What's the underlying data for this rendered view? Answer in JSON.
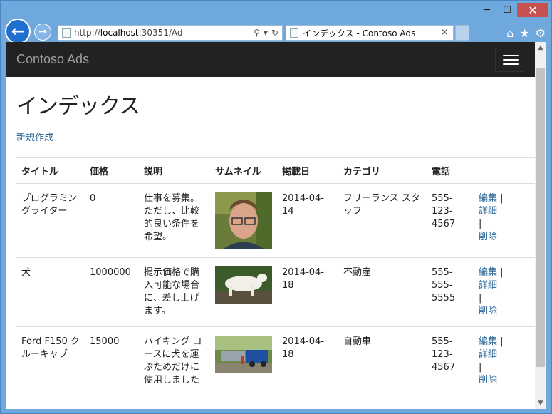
{
  "browser": {
    "url_prefix": "http://",
    "url_host": "localhost",
    "url_rest": ":30351/Ad",
    "tab_title": "インデックス - Contoso Ads",
    "minimize": "─",
    "maximize": "☐",
    "close": "✕"
  },
  "navbar": {
    "brand": "Contoso Ads"
  },
  "page": {
    "title": "インデックス",
    "create_link": "新規作成"
  },
  "table": {
    "headers": [
      "タイトル",
      "価格",
      "説明",
      "サムネイル",
      "掲載日",
      "カテゴリ",
      "電話"
    ],
    "rows": [
      {
        "title": "プログラミングライター",
        "price": "0",
        "description": "仕事を募集。ただし、比較的良い条件を希望。",
        "date": "2014-04-14",
        "category": "フリーランス スタッフ",
        "phone": "555-123-4567"
      },
      {
        "title": "犬",
        "price": "1000000",
        "description": "提示価格で購入可能な場合に、差し上げます。",
        "date": "2014-04-18",
        "category": "不動産",
        "phone": "555-555-5555"
      },
      {
        "title": "Ford F150 クルーキャブ",
        "price": "15000",
        "description": "ハイキング コースに犬を運ぶためだけに使用しました",
        "date": "2014-04-18",
        "category": "自動車",
        "phone": "555-123-4567"
      }
    ],
    "actions": {
      "edit": "編集",
      "details": "詳細",
      "delete": "削除",
      "separator": "|"
    }
  }
}
